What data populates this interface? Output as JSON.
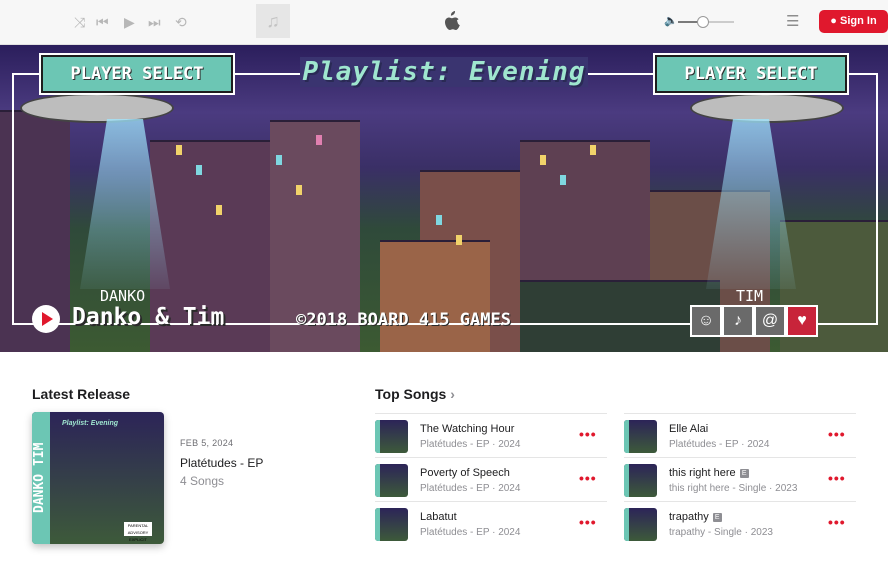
{
  "player": {
    "shuffle_icon": "⤨",
    "prev_icon": "⏮",
    "play_icon": "▶",
    "next_icon": "⏭",
    "repeat_icon": "⟲",
    "artwork_icon": "♫",
    "volume_icon": "🔈",
    "volume_level": 0.45,
    "queue_icon": "☰"
  },
  "header": {
    "signin_label": "Sign In"
  },
  "hero": {
    "player_select_left": "PLAYER SELECT",
    "player_select_right": "PLAYER SELECT",
    "playlist_title": "Playlist: Evening",
    "danko_label": "DANKO",
    "tim_label": "TIM",
    "artist_name": "Danko & Tim",
    "copyright": "©2018 BOARD 415 GAMES",
    "pixel_buttons": [
      "☺",
      "♪",
      "@",
      "♥"
    ]
  },
  "latest_release": {
    "section_title": "Latest Release",
    "art_side_text": "DANKO TIM",
    "art_title": "Playlist: Evening",
    "parental_advisory": "PARENTAL ADVISORY EXPLICIT CONTENT",
    "date": "FEB 5, 2024",
    "title": "Platétudes - EP",
    "song_count": "4 Songs"
  },
  "top_songs": {
    "section_title": "Top Songs",
    "chevron": "›",
    "more_label": "•••",
    "songs": [
      {
        "title": "The Watching Hour",
        "subtitle": "Platétudes - EP · 2024",
        "explicit": false
      },
      {
        "title": "Poverty of Speech",
        "subtitle": "Platétudes - EP · 2024",
        "explicit": false
      },
      {
        "title": "Labatut",
        "subtitle": "Platétudes - EP · 2024",
        "explicit": false
      },
      {
        "title": "Elle Alai",
        "subtitle": "Platétudes - EP · 2024",
        "explicit": false
      },
      {
        "title": "this right here",
        "subtitle": "this right here - Single · 2023",
        "explicit": true
      },
      {
        "title": "trapathy",
        "subtitle": "trapathy - Single · 2023",
        "explicit": true
      }
    ],
    "explicit_badge": "E"
  }
}
